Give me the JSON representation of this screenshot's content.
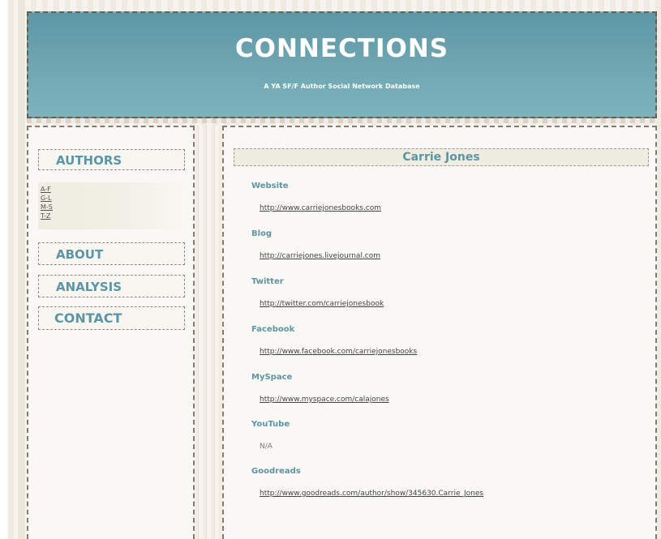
{
  "header": {
    "title": "CONNECTIONS",
    "subtitle": "A YA SF/F Author Social Network Database"
  },
  "sidebar": {
    "authors_label": "AUTHORS",
    "author_ranges": [
      "A-F",
      "G-L",
      "M-S",
      "T-Z"
    ],
    "about_label": "ABOUT",
    "analysis_label": "ANALYSIS",
    "contact_label": "CONTACT"
  },
  "author": {
    "name": "Carrie Jones",
    "fields": [
      {
        "label": "Website",
        "value": "http://www.carriejonesbooks.com",
        "is_link": true
      },
      {
        "label": "Blog",
        "value": "http://carriejones.livejournal.com",
        "is_link": true
      },
      {
        "label": "Twitter",
        "value": "http://twitter.com/carriejonesbook",
        "is_link": true
      },
      {
        "label": "Facebook",
        "value": "http://www.facebook.com/carriejonesbooks",
        "is_link": true
      },
      {
        "label": "MySpace",
        "value": "http://www.myspace.com/calajones",
        "is_link": true
      },
      {
        "label": "YouTube",
        "value": "N/A",
        "is_link": false
      },
      {
        "label": "Goodreads",
        "value": "http://www.goodreads.com/author/show/345630.Carrie_Jones",
        "is_link": true
      }
    ]
  },
  "colors": {
    "accent": "#5c95a3",
    "header_bg": "#6fa7b3",
    "panel_bg": "#f9f8f4",
    "dashed_border": "#857a6e"
  }
}
